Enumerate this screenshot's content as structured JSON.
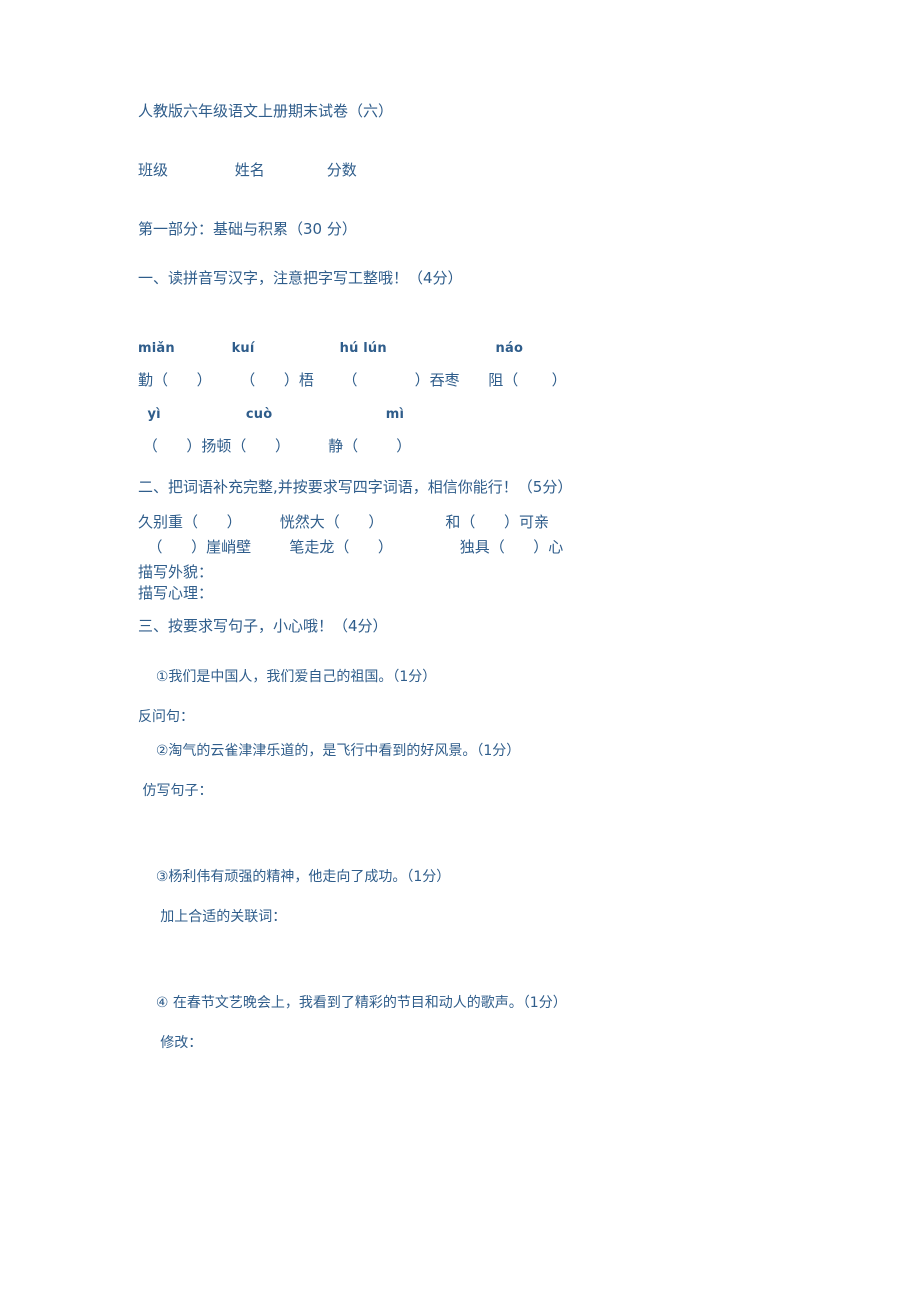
{
  "document": {
    "title": "人教版六年级语文上册期末试卷（六）",
    "header_fields": {
      "class_label": "班级",
      "name_label": "姓名",
      "score_label": "分数"
    },
    "part_one_heading": "第一部分：基础与积累（30 分）"
  },
  "section_one": {
    "heading": "一、读拼音写汉字，注意把字写工整哦！（4分）",
    "pinyin_row_1": {
      "p1": "miǎn",
      "p2": "kuí",
      "p3": "hú lún",
      "p4": "náo"
    },
    "answer_row_1": {
      "a1": "勤（      ）",
      "a2": "（      ）梧",
      "a3": "（            ）吞枣",
      "a4": "阻（       ）"
    },
    "pinyin_row_2": {
      "p1": "yì",
      "p2": "cuò",
      "p3": "mì"
    },
    "answer_row_2": {
      "a1": "（      ）扬顿（      ）",
      "a2": "静（        ）"
    }
  },
  "section_two": {
    "heading": "二、把词语补充完整,并按要求写四字词语，相信你能行！（5分）",
    "idiom_row_1": {
      "i1": "久别重（      ）",
      "i2": "恍然大（      ）",
      "i3": "和（      ）可亲"
    },
    "idiom_row_2": {
      "i1": "（      ）崖峭壁",
      "i2": "笔走龙（      ）",
      "i3": "独具（      ）心"
    },
    "prompt_appearance": "描写外貌：",
    "prompt_psychology": "描写心理："
  },
  "section_three": {
    "heading": "三、按要求写句子，小心哦！（4分）",
    "items": [
      {
        "text": "①我们是中国人，我们爱自己的祖国。（1分）",
        "instruction": "反问句："
      },
      {
        "text": "②淘气的云雀津津乐道的，是飞行中看到的好风景。（1分）",
        "instruction": "仿写句子："
      },
      {
        "text": "③杨利伟有顽强的精神，他走向了成功。（1分）",
        "instruction": "加上合适的关联词："
      },
      {
        "text": "④ 在春节文艺晚会上，我看到了精彩的节目和动人的歌声。（1分）",
        "instruction": "修改："
      }
    ]
  },
  "colors": {
    "text": "#2f5d8b",
    "background": "#ffffff"
  }
}
